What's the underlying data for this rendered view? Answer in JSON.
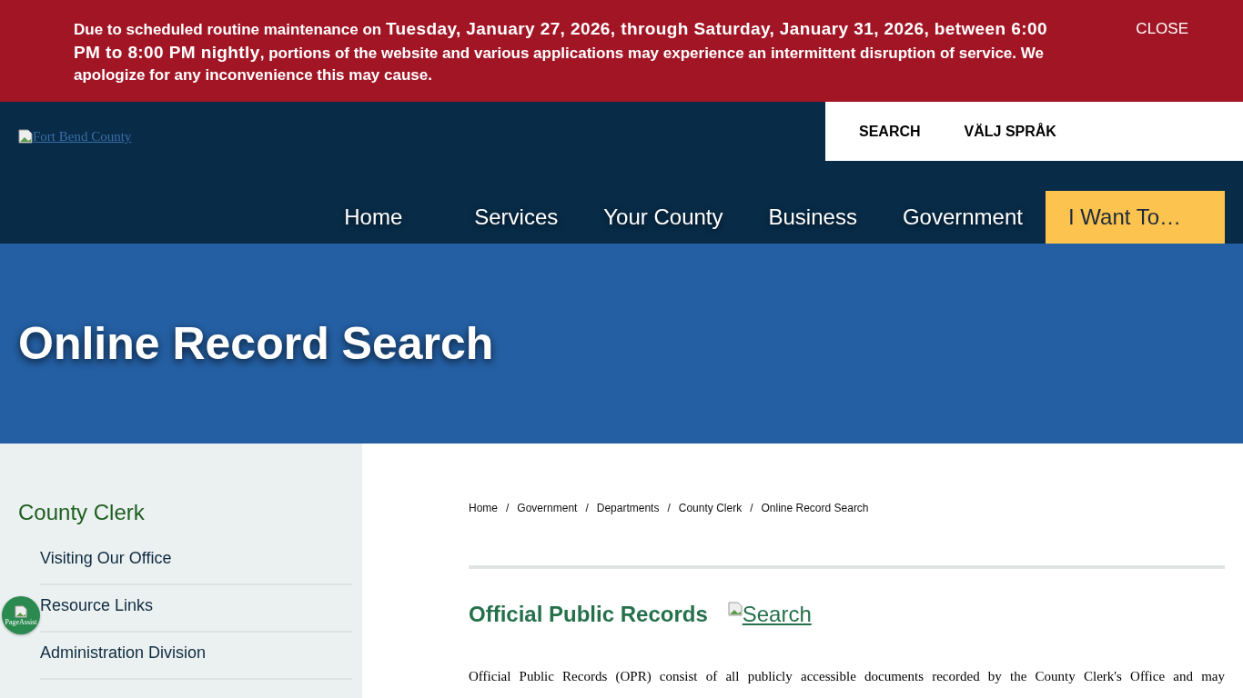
{
  "alert": {
    "text": "Due to scheduled routine maintenance on **Tuesday, January 27, 2026, through Saturday, January 31, 2026, between 6:00 PM to 8:00 PM nightly**, portions of the website and various applications may experience an intermittent disruption of service. We apologize for any inconvenience this may cause.",
    "close": "CLOSE"
  },
  "header": {
    "logo_alt": "Fort Bend County",
    "utility_links": [
      "SEARCH",
      "VÄLJ SPRÅK"
    ],
    "nav": [
      {
        "label": "Home",
        "highlighted": false
      },
      {
        "label": "Services",
        "highlighted": false
      },
      {
        "label": "Your County",
        "highlighted": false
      },
      {
        "label": "Business",
        "highlighted": false
      },
      {
        "label": "Government",
        "highlighted": false
      },
      {
        "label": "I Want To…",
        "highlighted": true
      }
    ]
  },
  "hero": {
    "title": "Online Record Search"
  },
  "sidebar": {
    "title": "County Clerk",
    "items": [
      "Visiting Our Office",
      "Resource Links",
      "Administration Division"
    ]
  },
  "floating_button": {
    "alt": "PageAssist"
  },
  "breadcrumb": {
    "separator": "/",
    "items": [
      "Home",
      "Government",
      "Departments",
      "County Clerk",
      "Online Record Search"
    ]
  },
  "content": {
    "heading": "Official Public Records",
    "search_link": "Search",
    "paragraph": "Official Public Records (OPR) consist of all publicly accessible documents recorded by the County Clerk's Office and may"
  }
}
